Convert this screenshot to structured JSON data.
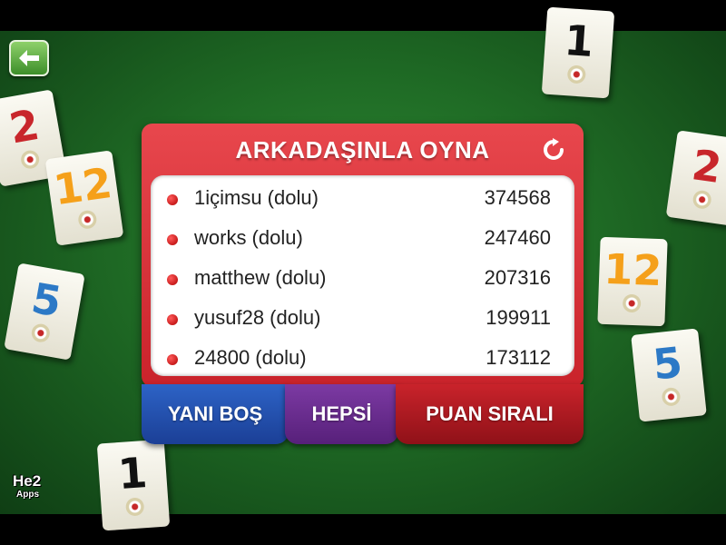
{
  "panel": {
    "title": "ARKADAŞINLA OYNA",
    "refresh_icon": "refresh-icon",
    "players": [
      {
        "name": "1içimsu (dolu)",
        "score": "374568"
      },
      {
        "name": "works (dolu)",
        "score": "247460"
      },
      {
        "name": "matthew (dolu)",
        "score": "207316"
      },
      {
        "name": "yusuf28 (dolu)",
        "score": "199911"
      },
      {
        "name": "24800 (dolu)",
        "score": "173112"
      }
    ]
  },
  "tabs": {
    "empty_label": "YANI BOŞ",
    "all_label": "HEPSİ",
    "points_label": "PUAN SIRALI"
  },
  "back_button": {
    "icon": "arrow-left-icon"
  },
  "tiles": [
    "2",
    "12",
    "5",
    "1",
    "2",
    "12",
    "5",
    "1"
  ],
  "logo": {
    "line1": "He2",
    "line2": "Apps"
  },
  "colors": {
    "felt": "#1f6b25",
    "panel_red": "#c9232b",
    "tab_blue": "#1b3f96",
    "tab_purple": "#57207a"
  }
}
